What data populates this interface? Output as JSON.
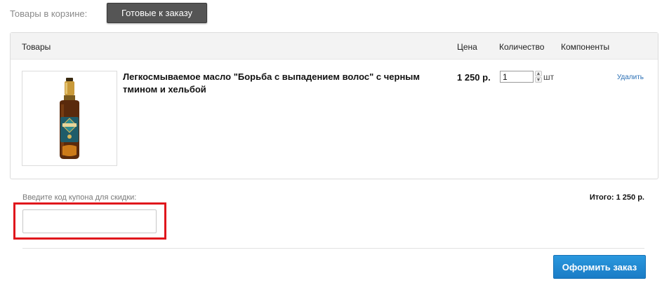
{
  "topbar": {
    "label": "Товары в корзине:",
    "ready_button": "Готовые к заказу"
  },
  "cart": {
    "headers": {
      "goods": "Товары",
      "price": "Цена",
      "quantity": "Количество",
      "components": "Компоненты"
    },
    "items": [
      {
        "name": "Легкосмываемое масло \"Борьба с выпадением волос\" с черным тмином и хельбой",
        "price": "1 250 р.",
        "quantity": "1",
        "unit": "шт",
        "remove_label": "Удалить"
      }
    ]
  },
  "coupon": {
    "label": "Введите код купона для скидки:",
    "value": "",
    "placeholder": ""
  },
  "summary": {
    "total": "Итого: 1 250 р."
  },
  "checkout": {
    "button_label": "Оформить заказ"
  },
  "colors": {
    "ready_button_bg": "#555555",
    "checkout_button_bg": "#1a7cc6",
    "highlight_border": "#e0161c",
    "link": "#2a6fb5"
  },
  "icons": {
    "product_image": "serum-bottle-image",
    "spinner_up": "spinner-up-icon",
    "spinner_down": "spinner-down-icon"
  }
}
